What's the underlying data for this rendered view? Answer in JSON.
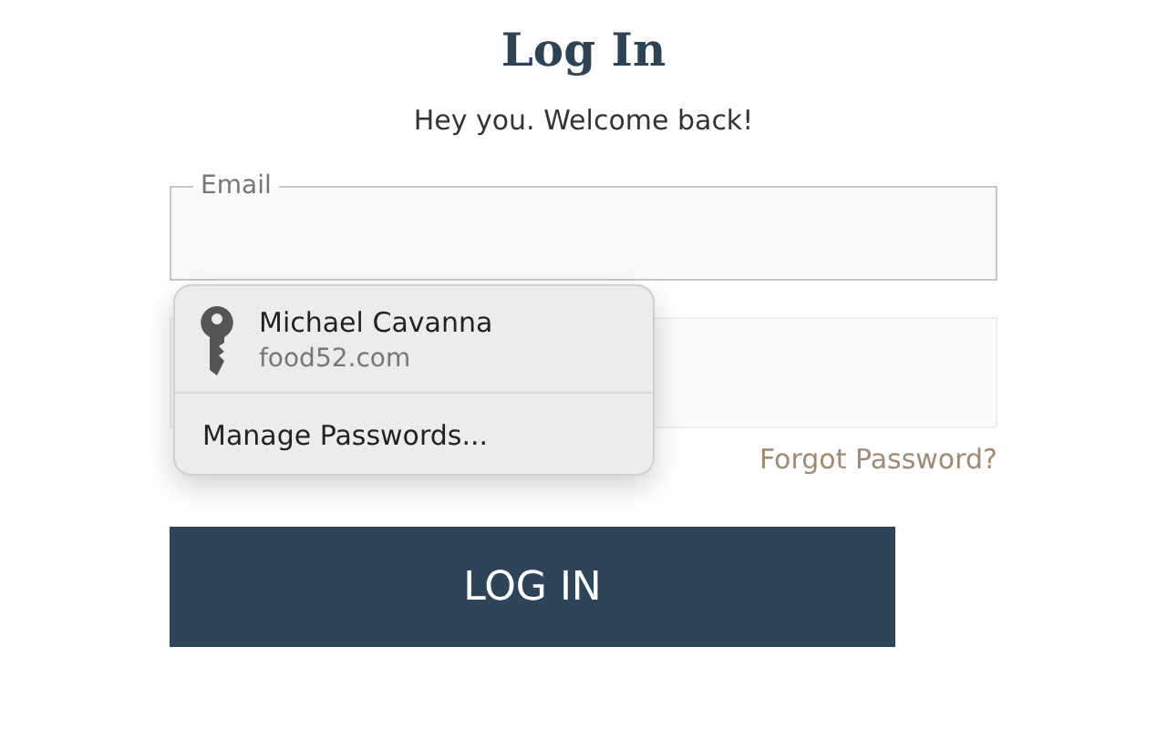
{
  "title": "Log In",
  "subtitle": "Hey you. Welcome back!",
  "email_field": {
    "label": "Email"
  },
  "forgot_link": "Forgot Password?",
  "login_button": "LOG IN",
  "autofill_popup": {
    "account": {
      "name": "Michael Cavanna",
      "site": "food52.com"
    },
    "manage": "Manage Passwords..."
  }
}
